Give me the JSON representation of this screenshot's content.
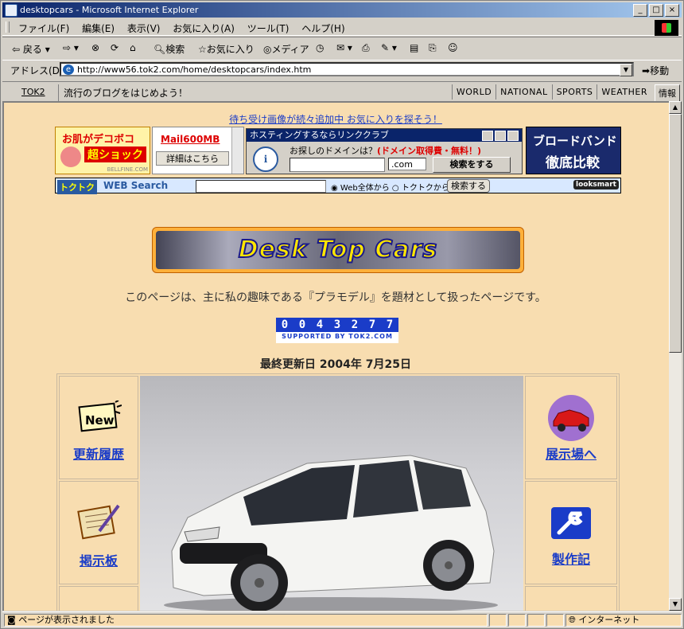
{
  "window": {
    "title": "desktopcars - Microsoft Internet Explorer"
  },
  "menu": [
    "ファイル(F)",
    "編集(E)",
    "表示(V)",
    "お気に入り(A)",
    "ツール(T)",
    "ヘルプ(H)"
  ],
  "toolbar": {
    "back": "戻る",
    "search": "検索",
    "favorites": "お気に入り",
    "media": "メディア"
  },
  "address": {
    "label": "アドレス(D)",
    "url": "http://www56.tok2.com/home/desktopcars/index.htm",
    "go": "移動"
  },
  "links": {
    "tok2": "TOK2",
    "blog": "流行のブログをはじめよう！",
    "nav": [
      "WORLD",
      "NATIONAL",
      "SPORTS",
      "WEATHER"
    ],
    "info": "情報"
  },
  "page": {
    "promo": "待ち受け画像が続々追加中 お気に入りを探そう！",
    "ad1": {
      "line1": "お肌がデコボコ",
      "line2": "超ショック",
      "domain": "BELLFINE.COM"
    },
    "ad2": {
      "mail": "Mail600MB",
      "button": "詳細はこちら"
    },
    "ad3": {
      "title": "ホスティングするならリンククラブ",
      "question": "お探しのドメインは？",
      "note": "(ドメイン取得費・無料！)",
      "tld": ".com",
      "button": "検索をする"
    },
    "ad4": {
      "line1": "ブロードバンド",
      "line2": "徹底比較"
    },
    "websearch": {
      "logo": "トクトク",
      "label": "WEB Search",
      "opt1": "Web全体から",
      "opt2": "トクトクから",
      "button": "検索する",
      "powered": "looksmart"
    },
    "banner": "Desk Top Cars",
    "description": "このページは、主に私の趣味である『プラモデル』を題材として扱ったページです。",
    "counter": {
      "digits": [
        "0",
        "0",
        "4",
        "3",
        "2",
        "7",
        "7"
      ],
      "caption": "SUPPORTED BY TOK2.COM"
    },
    "updated": "最終更新日 2004年 7月25日",
    "nav_left": [
      "更新履歴",
      "掲示板"
    ],
    "nav_right": [
      "展示場へ",
      "製作記"
    ],
    "new_badge": "New"
  },
  "status": {
    "text": "ページが表示されました",
    "zone": "インターネット"
  }
}
